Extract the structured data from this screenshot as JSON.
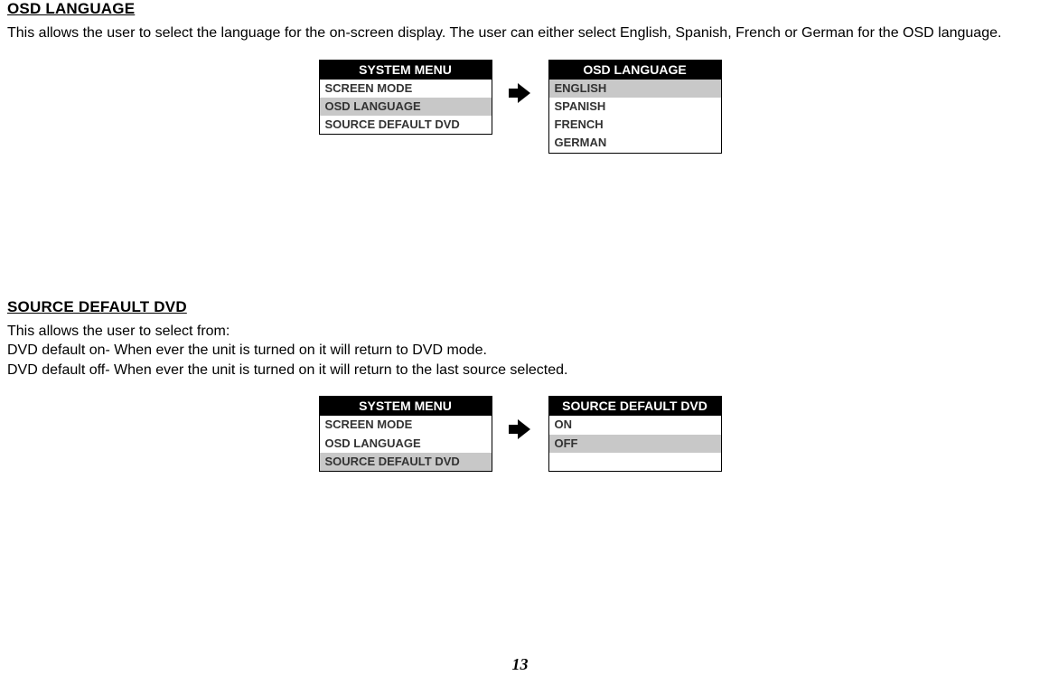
{
  "section1": {
    "heading": "OSD LANGUAGE",
    "text": "This allows the user to select the language for the on-screen display. The user can either select English, Spanish, French or German for the OSD language."
  },
  "menu1": {
    "left": {
      "title": "SYSTEM MENU",
      "items": [
        {
          "label": "SCREEN MODE",
          "selected": false
        },
        {
          "label": "OSD LANGUAGE",
          "selected": true
        },
        {
          "label": "SOURCE DEFAULT DVD",
          "selected": false
        }
      ]
    },
    "right": {
      "title": "OSD LANGUAGE",
      "items": [
        {
          "label": "ENGLISH",
          "selected": true
        },
        {
          "label": "SPANISH",
          "selected": false
        },
        {
          "label": "FRENCH",
          "selected": false
        },
        {
          "label": "GERMAN",
          "selected": false
        }
      ]
    }
  },
  "section2": {
    "heading": "SOURCE DEFAULT DVD",
    "line1": "This allows the user to select from:",
    "line2": "DVD default on-  When ever the unit is turned on it will return to DVD mode.",
    "line3": "DVD default off-  When ever the unit is turned on it will return to the last source selected."
  },
  "menu2": {
    "left": {
      "title": "SYSTEM MENU",
      "items": [
        {
          "label": "SCREEN MODE",
          "selected": false
        },
        {
          "label": "OSD LANGUAGE",
          "selected": false
        },
        {
          "label": "SOURCE DEFAULT DVD",
          "selected": true
        }
      ]
    },
    "right": {
      "title": "SOURCE DEFAULT DVD",
      "items": [
        {
          "label": "ON",
          "selected": false
        },
        {
          "label": "OFF",
          "selected": true
        },
        {
          "label": "",
          "selected": false
        }
      ]
    }
  },
  "pageNumber": "13"
}
